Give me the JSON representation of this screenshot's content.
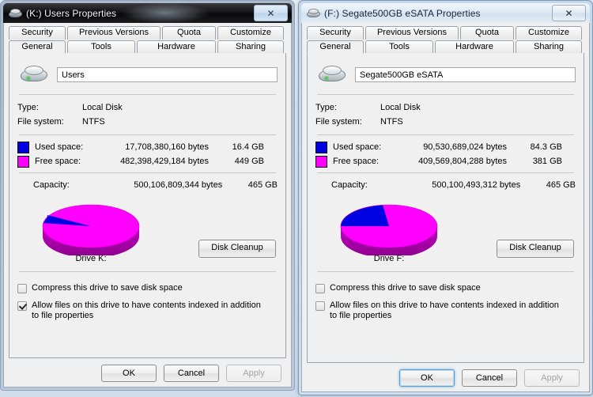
{
  "desktop": {
    "background_color": "#dfe8f2"
  },
  "windows": [
    {
      "id": "users-k",
      "active": false,
      "title": "(K:) Users  Properties",
      "close_label": "✕",
      "tabs_row1": [
        "Security",
        "Previous Versions",
        "Quota",
        "Customize"
      ],
      "tabs_row2": [
        "General",
        "Tools",
        "Hardware",
        "Sharing"
      ],
      "selected_tab": "General",
      "volume_name": "Users",
      "info": [
        {
          "label": "Type:",
          "value": "Local Disk"
        },
        {
          "label": "File system:",
          "value": "NTFS"
        }
      ],
      "space": [
        {
          "label": "Used space:",
          "bytes": "17,708,380,160 bytes",
          "gb": "16.4 GB",
          "color": "#0000E0"
        },
        {
          "label": "Free space:",
          "bytes": "482,398,429,184 bytes",
          "gb": "449 GB",
          "color": "#FF00FF"
        }
      ],
      "capacity": {
        "label": "Capacity:",
        "bytes": "500,106,809,344 bytes",
        "gb": "465 GB"
      },
      "pie_caption": "Drive K:",
      "cleanup_label": "Disk Cleanup",
      "checkboxes": [
        {
          "label": "Compress this drive to save disk space",
          "checked": false
        },
        {
          "label": "Allow files on this drive to have contents indexed in addition to file properties",
          "checked": true
        }
      ],
      "buttons": [
        {
          "label": "OK",
          "focused": false,
          "disabled": false
        },
        {
          "label": "Cancel",
          "focused": false,
          "disabled": false
        },
        {
          "label": "Apply",
          "focused": false,
          "disabled": true
        }
      ],
      "chart_data": {
        "type": "pie",
        "title": "Drive K:",
        "categories": [
          "Used space",
          "Free space"
        ],
        "values": [
          17708380160,
          482398429184
        ],
        "percentages": [
          3.5,
          96.5
        ],
        "colors": [
          "#0000E0",
          "#FF00FF"
        ],
        "labels": [
          "16.4 GB",
          "449 GB"
        ],
        "legend": "left",
        "grid": false
      }
    },
    {
      "id": "segate-f",
      "active": true,
      "title": "(F:) Segate500GB eSATA Properties",
      "close_label": "✕",
      "tabs_row1": [
        "Security",
        "Previous Versions",
        "Quota",
        "Customize"
      ],
      "tabs_row2": [
        "General",
        "Tools",
        "Hardware",
        "Sharing"
      ],
      "selected_tab": "General",
      "volume_name": "Segate500GB eSATA",
      "info": [
        {
          "label": "Type:",
          "value": "Local Disk"
        },
        {
          "label": "File system:",
          "value": "NTFS"
        }
      ],
      "space": [
        {
          "label": "Used space:",
          "bytes": "90,530,689,024 bytes",
          "gb": "84.3 GB",
          "color": "#0000E0"
        },
        {
          "label": "Free space:",
          "bytes": "409,569,804,288 bytes",
          "gb": "381 GB",
          "color": "#FF00FF"
        }
      ],
      "capacity": {
        "label": "Capacity:",
        "bytes": "500,100,493,312 bytes",
        "gb": "465 GB"
      },
      "pie_caption": "Drive F:",
      "cleanup_label": "Disk Cleanup",
      "checkboxes": [
        {
          "label": "Compress this drive to save disk space",
          "checked": false
        },
        {
          "label": "Allow files on this drive to have contents indexed in addition to file properties",
          "checked": false
        }
      ],
      "buttons": [
        {
          "label": "OK",
          "focused": true,
          "disabled": false
        },
        {
          "label": "Cancel",
          "focused": false,
          "disabled": false
        },
        {
          "label": "Apply",
          "focused": false,
          "disabled": true
        }
      ],
      "chart_data": {
        "type": "pie",
        "title": "Drive F:",
        "categories": [
          "Used space",
          "Free space"
        ],
        "values": [
          90530689024,
          409569804288
        ],
        "percentages": [
          18.1,
          81.9
        ],
        "colors": [
          "#0000E0",
          "#FF00FF"
        ],
        "labels": [
          "84.3 GB",
          "381 GB"
        ],
        "legend": "left",
        "grid": false
      }
    }
  ]
}
